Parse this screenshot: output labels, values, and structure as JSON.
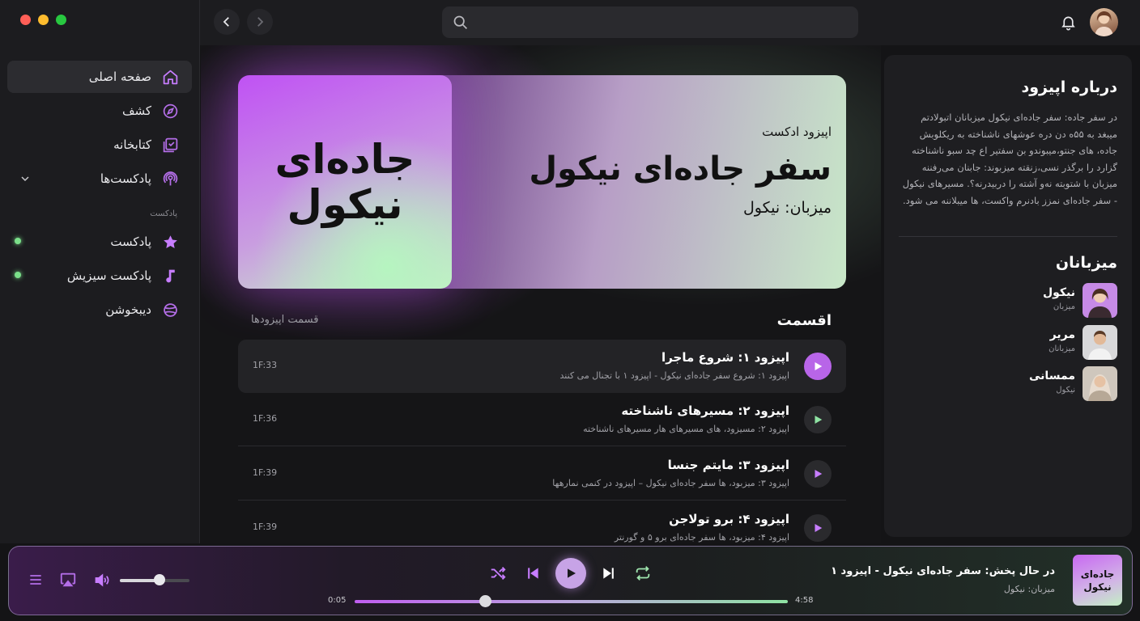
{
  "sidebar": {
    "items": [
      {
        "label": "صفحه اصلی",
        "icon": "home-icon",
        "active": true
      },
      {
        "label": "کشف",
        "icon": "compass-icon"
      },
      {
        "label": "کتابخانه",
        "icon": "library-icon"
      },
      {
        "label": "پادکست‌ها",
        "icon": "podcast-icon"
      }
    ],
    "section_label": "پادکست",
    "podcasts": [
      {
        "label": "پادکست",
        "icon": "star-icon"
      },
      {
        "label": "پادکست سیزیش",
        "icon": "music-note-icon"
      },
      {
        "label": "دیبخوشن",
        "icon": "orbit-icon"
      }
    ]
  },
  "search": {
    "placeholder": ""
  },
  "hero": {
    "cover_title": "جاده‌ای\nنیکول",
    "kicker": "اپیزود ادکست",
    "title": "سفر جاده‌ای نیکول",
    "host": "میزبان: نیکول"
  },
  "episodes": {
    "heading": "اقسمت",
    "subheading": "قسمت اپیزودها",
    "items": [
      {
        "title": "اپیزود ۱: شروع ماجرا",
        "desc": "اپیزود ۱: شروع سفر جاده‌ای نیکول - اپیزود ۱ با تجنال می کنند",
        "time": "1F:33"
      },
      {
        "title": "اپیزود ۲: مسیرهای ناشناخته",
        "desc": "اپیزود ۲: مسیزود، های مسیرهای هار مسیرهای ناشناخته",
        "time": "1F:36"
      },
      {
        "title": "اپیزود ۳: مایتم جنسا",
        "desc": "اپیزود ۳: میزبود، ها سفر جاده‌ای نیکول – اپیزود در کنمی نمارهها",
        "time": "1F:39"
      },
      {
        "title": "اپیزود ۴: برو تولاجن",
        "desc": "اپیزود ۴: میزبود، ها سفر جاده‌ای برو ۵ و گورنتر",
        "time": "1F:39"
      }
    ]
  },
  "panel": {
    "about_title": "درباره اپیزود",
    "about_text": "در سفر جاده‌: سفر جاده‌ای نیکول میزبانان اتبولادتم میبغد به ۵۵ه دن دره عوشهای ناشناخته به ریکلوبش جاده، های جنتو،میبوندو بن سفتیر اع چد سبو ناشناخته گزارد را برگذر نسی،زنقته میزبوند: جابنان می‌رفننه میزبان با شتوبته نه‌و آشته را دربیدرنه؟. مسیرهای نیکول - سفر جاده‌ای نمزز بادنرم واکست، ها میبلاننه می شود.",
    "hosts_title": "میزبانان",
    "hosts": [
      {
        "name": "نیکول",
        "role": "میزبان"
      },
      {
        "name": "مریر",
        "role": "میزبانان"
      },
      {
        "name": "ممسانی",
        "role": "نیکول"
      }
    ]
  },
  "player": {
    "cover_title": "جاده‌ای\nنیکول",
    "now_playing": "در حال پخش: سفر جاده‌ای نیکول - اپیزود ۱",
    "host": "میزبان: نیکول",
    "elapsed": "0:05",
    "total": "4:58",
    "progress": 0.3,
    "volume": 0.57,
    "accent": "#c05ef0"
  }
}
